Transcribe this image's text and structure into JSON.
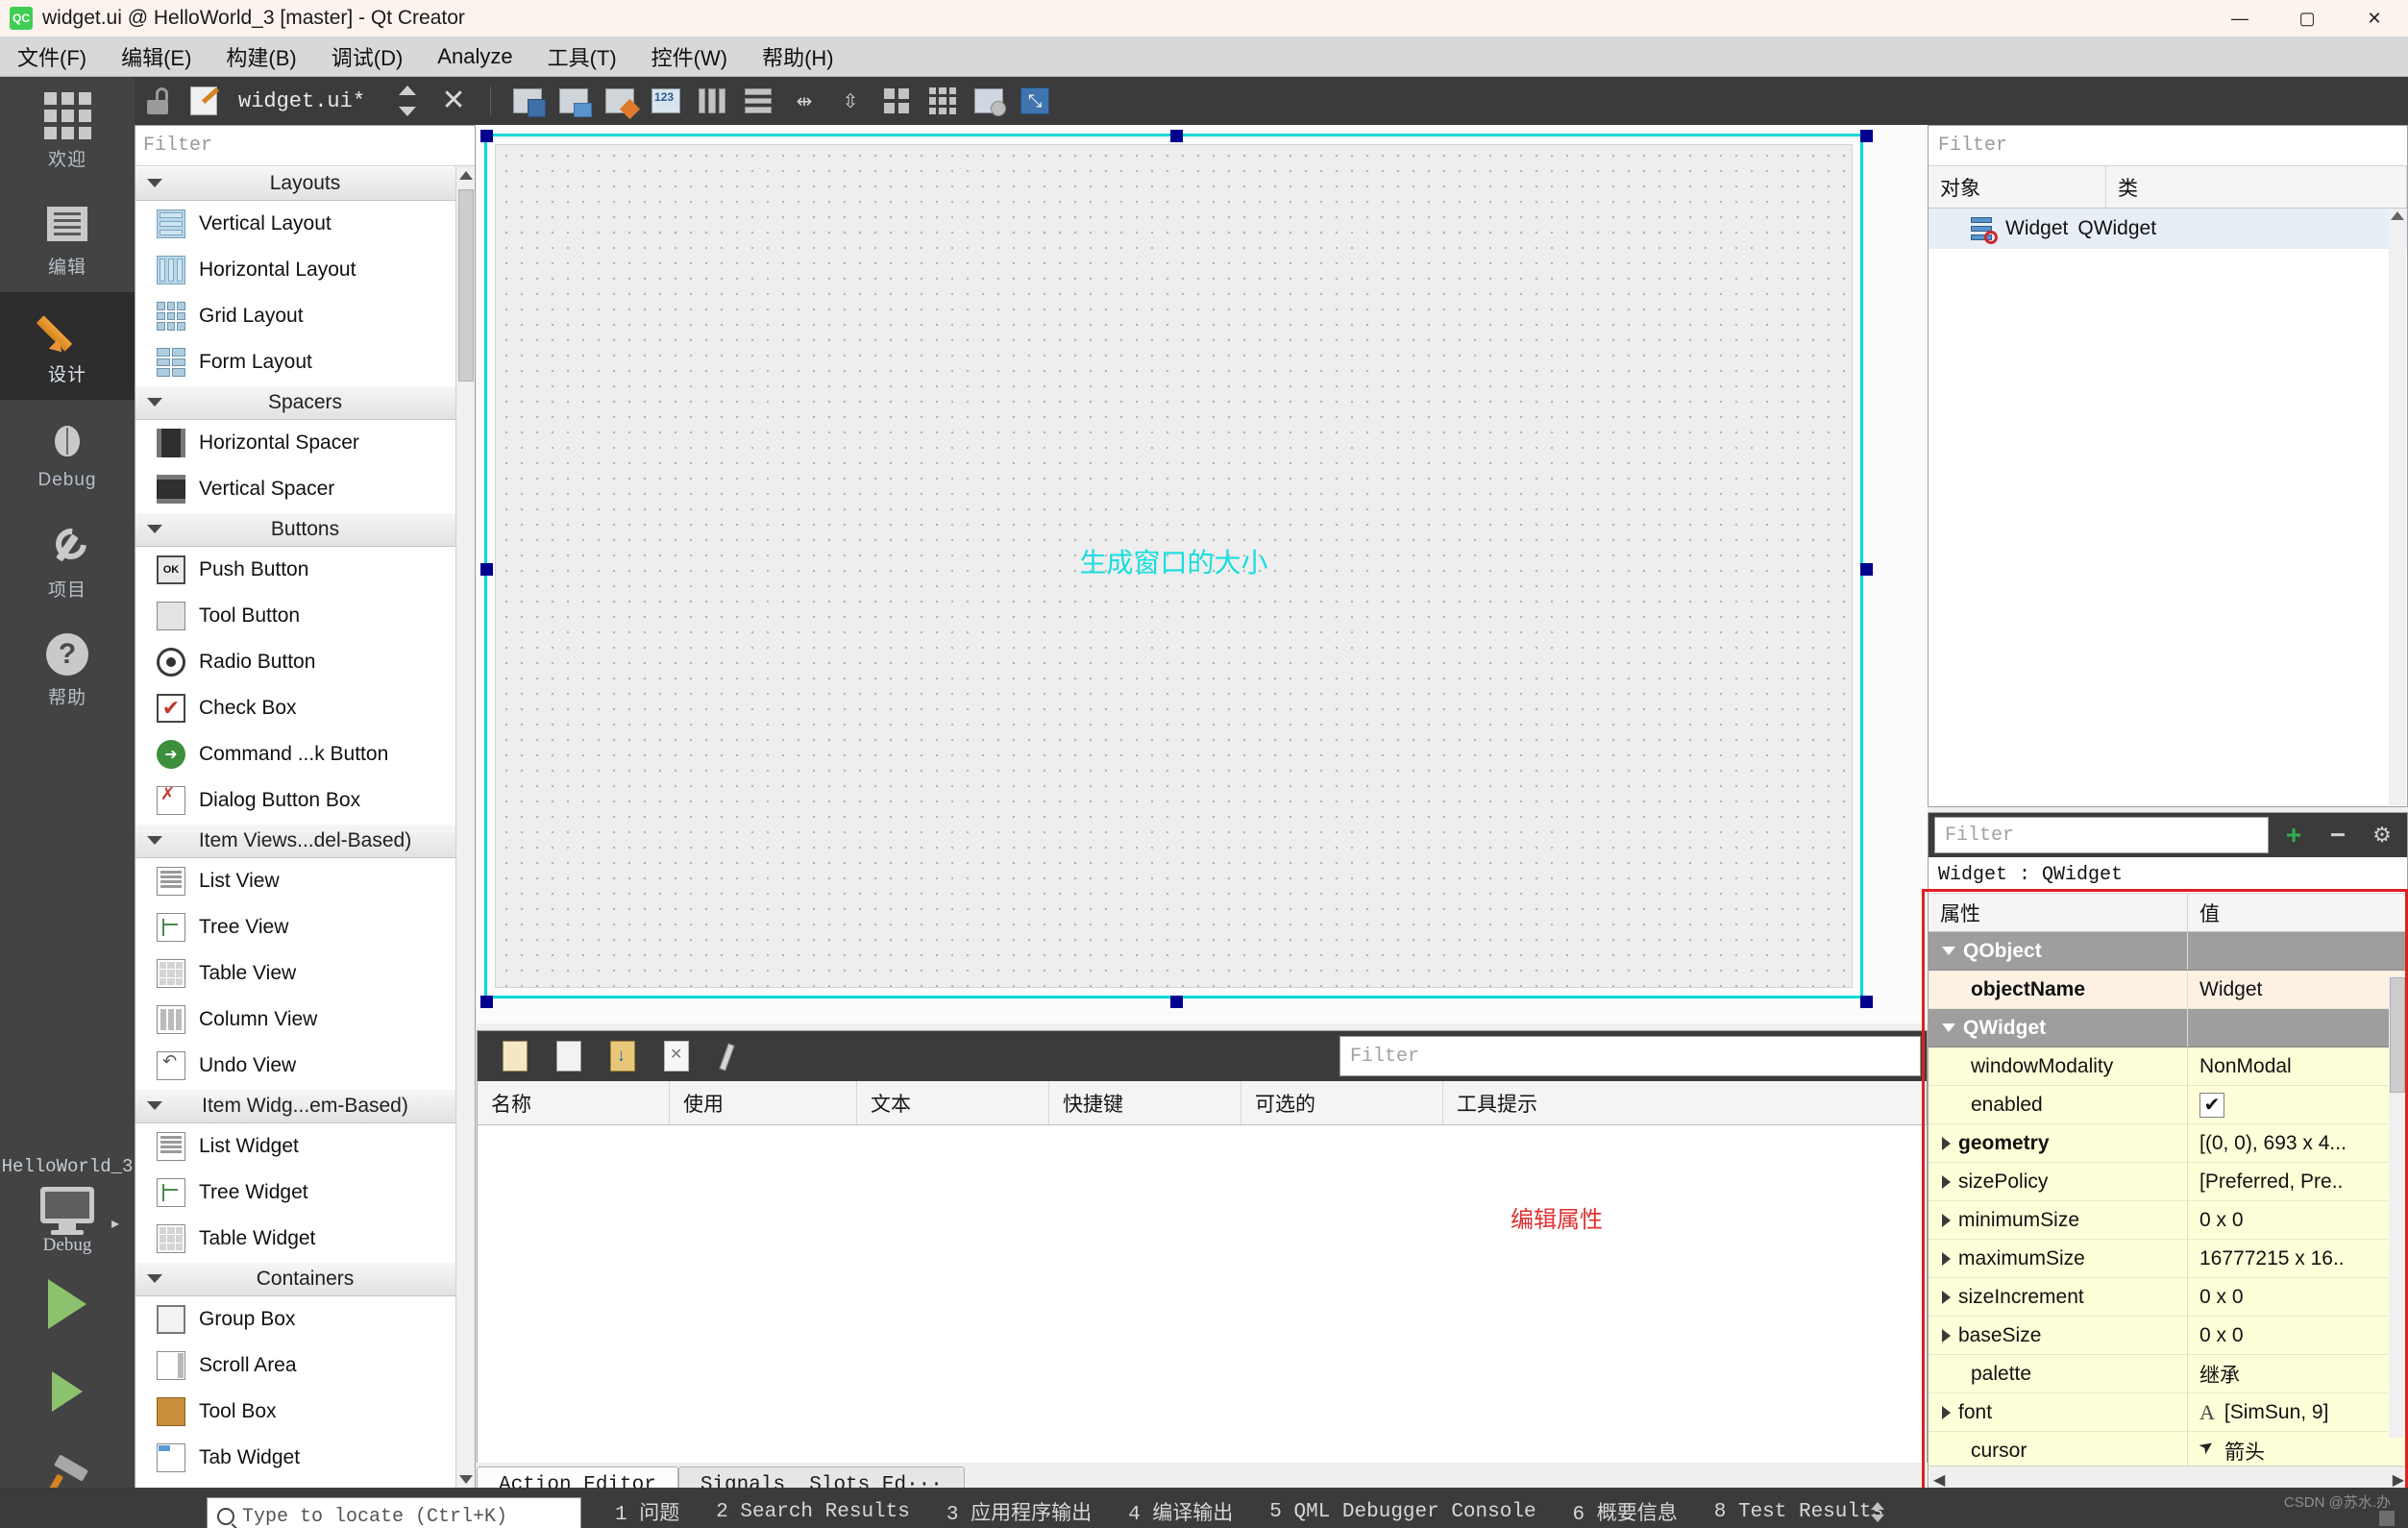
{
  "window": {
    "title": "widget.ui @ HelloWorld_3 [master] - Qt Creator",
    "logo_text": "QC",
    "minimize": "—",
    "maximize": "▢",
    "close": "✕"
  },
  "menubar": {
    "items": [
      {
        "label": "文件(F)"
      },
      {
        "label": "编辑(E)"
      },
      {
        "label": "构建(B)"
      },
      {
        "label": "调试(D)"
      },
      {
        "label": "Analyze"
      },
      {
        "label": "工具(T)"
      },
      {
        "label": "控件(W)"
      },
      {
        "label": "帮助(H)"
      }
    ]
  },
  "modebar": {
    "items": [
      {
        "label": "欢迎",
        "icon": "grid-icon",
        "active": false
      },
      {
        "label": "编辑",
        "icon": "document-icon",
        "active": false
      },
      {
        "label": "设计",
        "icon": "pencil-icon",
        "active": true
      },
      {
        "label": "Debug",
        "icon": "bug-icon",
        "active": false
      },
      {
        "label": "项目",
        "icon": "wrench-icon",
        "active": false
      },
      {
        "label": "帮助",
        "icon": "question-icon",
        "active": false
      }
    ],
    "kit": {
      "project": "HelloWorld_3",
      "build_config": "Debug",
      "monitor_icon": "monitor-icon",
      "expand_arrow": "▸",
      "run_icon": "play-triangle-icon",
      "debug_icon": "play-debug-icon",
      "build_icon": "hammer-icon"
    }
  },
  "designer_toolbar": {
    "lock_icon": "lock-open-icon",
    "file_icon": "edit-file-icon",
    "filename": "widget.ui*",
    "buttons": [
      {
        "name": "split-updown-button",
        "icon": "up-down-arrows-icon"
      },
      {
        "name": "close-split-button",
        "icon": "close-x-icon"
      },
      {
        "name": "edit-widgets-button",
        "icon": "edit-widgets-icon"
      },
      {
        "name": "edit-signals-slots-button",
        "icon": "signals-slots-icon"
      },
      {
        "name": "edit-buddies-button",
        "icon": "buddies-icon"
      },
      {
        "name": "edit-tab-order-button",
        "icon": "tab-order-icon"
      },
      {
        "name": "layout-horizontally-button",
        "icon": "layout-horizontal-icon"
      },
      {
        "name": "layout-vertically-button",
        "icon": "layout-vertical-icon"
      },
      {
        "name": "layout-splitter-h-button",
        "icon": "splitter-horizontal-icon"
      },
      {
        "name": "layout-splitter-v-button",
        "icon": "splitter-vertical-icon"
      },
      {
        "name": "layout-form-button",
        "icon": "form-layout-icon"
      },
      {
        "name": "layout-grid-button",
        "icon": "grid-layout-icon"
      },
      {
        "name": "break-layout-button",
        "icon": "break-layout-icon"
      },
      {
        "name": "adjust-size-button",
        "icon": "adjust-size-icon"
      }
    ]
  },
  "widget_box": {
    "filter_placeholder": "Filter",
    "sections": [
      {
        "title": "Layouts",
        "items": [
          {
            "label": "Vertical Layout",
            "icon": "vertical-layout-icon"
          },
          {
            "label": "Horizontal Layout",
            "icon": "horizontal-layout-icon"
          },
          {
            "label": "Grid Layout",
            "icon": "grid-layout-icon"
          },
          {
            "label": "Form Layout",
            "icon": "form-layout-icon"
          }
        ]
      },
      {
        "title": "Spacers",
        "items": [
          {
            "label": "Horizontal Spacer",
            "icon": "horizontal-spacer-icon"
          },
          {
            "label": "Vertical Spacer",
            "icon": "vertical-spacer-icon"
          }
        ]
      },
      {
        "title": "Buttons",
        "items": [
          {
            "label": "Push Button",
            "icon": "push-button-icon"
          },
          {
            "label": "Tool Button",
            "icon": "tool-button-icon"
          },
          {
            "label": "Radio Button",
            "icon": "radio-button-icon"
          },
          {
            "label": "Check Box",
            "icon": "check-box-icon"
          },
          {
            "label": "Command ...k Button",
            "icon": "command-link-button-icon"
          },
          {
            "label": "Dialog Button Box",
            "icon": "dialog-button-box-icon"
          }
        ]
      },
      {
        "title": "Item Views...del-Based)",
        "items": [
          {
            "label": "List View",
            "icon": "list-view-icon"
          },
          {
            "label": "Tree View",
            "icon": "tree-view-icon"
          },
          {
            "label": "Table View",
            "icon": "table-view-icon"
          },
          {
            "label": "Column View",
            "icon": "column-view-icon"
          },
          {
            "label": "Undo View",
            "icon": "undo-view-icon"
          }
        ]
      },
      {
        "title": "Item Widg...em-Based)",
        "items": [
          {
            "label": "List Widget",
            "icon": "list-widget-icon"
          },
          {
            "label": "Tree Widget",
            "icon": "tree-widget-icon"
          },
          {
            "label": "Table Widget",
            "icon": "table-widget-icon"
          }
        ]
      },
      {
        "title": "Containers",
        "items": [
          {
            "label": "Group Box",
            "icon": "group-box-icon"
          },
          {
            "label": "Scroll Area",
            "icon": "scroll-area-icon"
          },
          {
            "label": "Tool Box",
            "icon": "tool-box-icon"
          },
          {
            "label": "Tab Widget",
            "icon": "tab-widget-icon"
          }
        ]
      }
    ]
  },
  "canvas": {
    "annotation": "生成窗口的大小",
    "annotation_color": "#16dede",
    "selection_color": "#00d8d8",
    "handle_color": "#00008f"
  },
  "action_editor": {
    "filter_placeholder": "Filter",
    "toolbar_buttons": [
      {
        "name": "new-action-button",
        "icon": "new-page-icon"
      },
      {
        "name": "copy-action-button",
        "icon": "copy-page-icon"
      },
      {
        "name": "paste-action-button",
        "icon": "paste-page-icon"
      },
      {
        "name": "delete-action-button",
        "icon": "delete-page-icon"
      },
      {
        "name": "edit-action-button",
        "icon": "edit-tool-icon"
      }
    ],
    "columns": [
      "名称",
      "使用",
      "文本",
      "快捷键",
      "可选的",
      "工具提示"
    ],
    "rows": [],
    "annotation": "编辑属性",
    "annotation_color": "#e03030",
    "tabs": [
      {
        "label": "Action Editor",
        "active": true
      },
      {
        "label": "Signals _Slots Ed···",
        "active": false
      }
    ]
  },
  "object_inspector": {
    "filter_placeholder": "Filter",
    "columns": [
      "对象",
      "类"
    ],
    "rows": [
      {
        "object": "Widget",
        "class": "QWidget",
        "icon": "qwidget-icon"
      }
    ]
  },
  "property_editor": {
    "filter_placeholder": "Filter",
    "add_button": "+",
    "remove_button": "−",
    "config_button": "⚙",
    "object_line": "Widget : QWidget",
    "columns": [
      "属性",
      "值"
    ],
    "rows": [
      {
        "name": "QObject",
        "value": "",
        "type": "group",
        "expanded": true
      },
      {
        "name": "objectName",
        "value": "Widget",
        "type": "prop",
        "bold": true,
        "shade": "alt"
      },
      {
        "name": "QWidget",
        "value": "",
        "type": "group",
        "expanded": true
      },
      {
        "name": "windowModality",
        "value": "NonModal",
        "type": "prop",
        "shade": "ylw"
      },
      {
        "name": "enabled",
        "value": "✔",
        "type": "checkbox",
        "shade": "ylw"
      },
      {
        "name": "geometry",
        "value": "[(0, 0), 693 x 4...",
        "type": "expandable",
        "bold": true,
        "shade": "ylw"
      },
      {
        "name": "sizePolicy",
        "value": "[Preferred, Pre..",
        "type": "expandable",
        "shade": "ylw"
      },
      {
        "name": "minimumSize",
        "value": "0 x 0",
        "type": "expandable",
        "shade": "ylw"
      },
      {
        "name": "maximumSize",
        "value": "16777215 x 16..",
        "type": "expandable",
        "shade": "ylw"
      },
      {
        "name": "sizeIncrement",
        "value": "0 x 0",
        "type": "expandable",
        "shade": "ylw"
      },
      {
        "name": "baseSize",
        "value": "0 x 0",
        "type": "expandable",
        "shade": "ylw"
      },
      {
        "name": "palette",
        "value": "继承",
        "type": "prop",
        "shade": "ylw"
      },
      {
        "name": "font",
        "value": "[SimSun, 9]",
        "type": "font",
        "shade": "ylw"
      },
      {
        "name": "cursor",
        "value": "箭头",
        "type": "cursor",
        "shade": "ylw"
      }
    ],
    "highlight_color": "#e02020"
  },
  "statusbar": {
    "locator_placeholder": "Type to locate (Ctrl+K)",
    "locator_icon": "search-icon",
    "outputs": [
      "1 问题",
      "2 Search Results",
      "3 应用程序输出",
      "4 编译输出",
      "5 QML Debugger Console",
      "6 概要信息",
      "8 Test Results"
    ],
    "watermark": "CSDN @苏水.办"
  }
}
